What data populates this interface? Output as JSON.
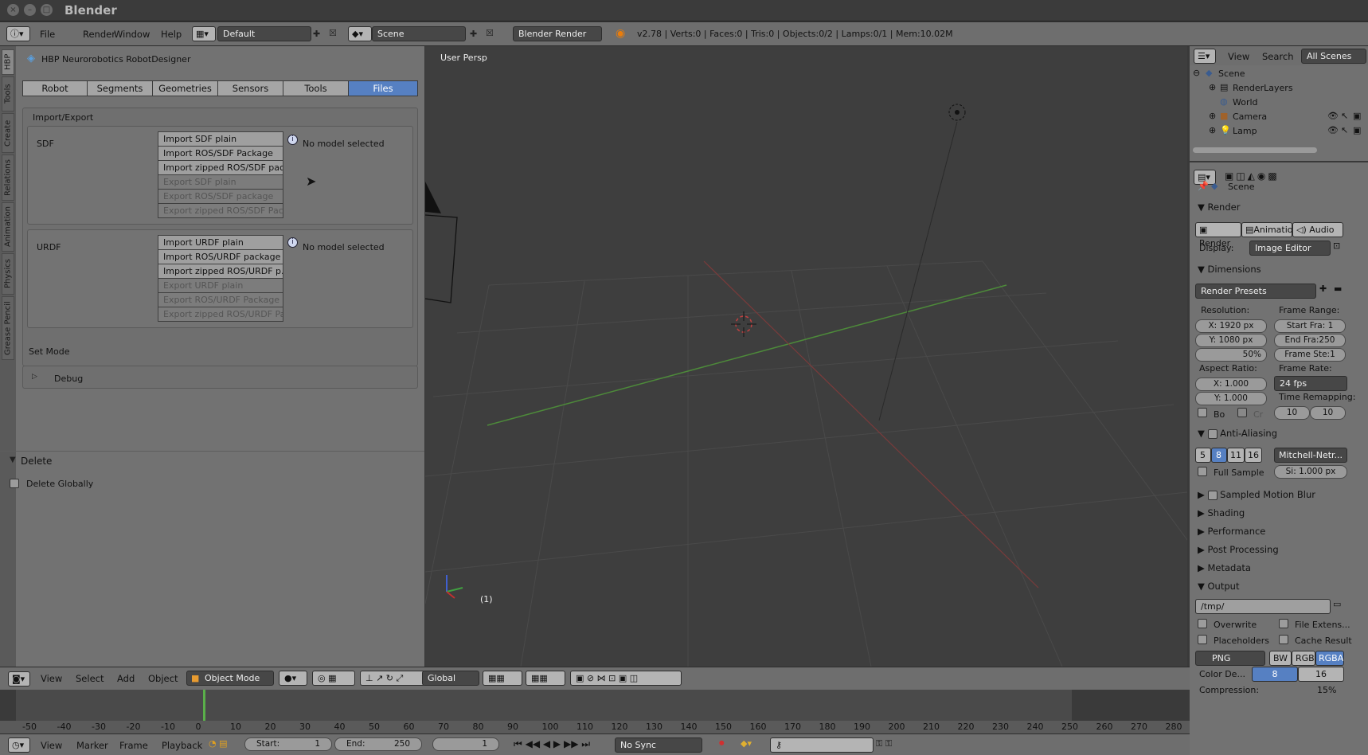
{
  "window": {
    "title": "Blender"
  },
  "info_header": {
    "menus": [
      "File",
      "Render",
      "Window",
      "Help"
    ],
    "layout": "Default",
    "scene": "Scene",
    "engine": "Blender Render",
    "stats": "v2.78 | Verts:0 | Faces:0 | Tris:0 | Objects:0/2 | Lamps:0/1 | Mem:10.02M"
  },
  "vertical_tabs": [
    "HBP",
    "Tools",
    "Create",
    "Relations",
    "Animation",
    "Physics",
    "Grease Pencil"
  ],
  "robot_designer": {
    "title": "HBP Neurorobotics RobotDesigner",
    "tabs": [
      "Robot",
      "Segments",
      "Geometries",
      "Sensors",
      "Tools",
      "Files"
    ],
    "active_tab": "Files",
    "section_label": "Import/Export",
    "sdf": {
      "label": "SDF",
      "buttons": [
        "Import SDF plain",
        "Import ROS/SDF Package",
        "Import zipped ROS/SDF pac...",
        "Export SDF plain",
        "Export ROS/SDF package",
        "Export zipped ROS/SDF Pac..."
      ],
      "status": "No model selected"
    },
    "urdf": {
      "label": "URDF",
      "buttons": [
        "Import URDF plain",
        "Import ROS/URDF package",
        "Import zipped ROS/URDF p...",
        "Export URDF plain",
        "Export ROS/URDF Package",
        "Export zipped ROS/URDF Pa..."
      ],
      "status": "No model selected"
    },
    "set_mode": "Set Mode",
    "debug": "Debug"
  },
  "delete_panel": {
    "title": "Delete",
    "option": "Delete Globally"
  },
  "viewport": {
    "label": "User Persp",
    "frame": "(1)"
  },
  "viewport_header": {
    "menus": [
      "View",
      "Select",
      "Add",
      "Object"
    ],
    "mode": "Object Mode",
    "orientation": "Global"
  },
  "timeline": {
    "ticks": [
      "-50",
      "-40",
      "-30",
      "-20",
      "-10",
      "0",
      "10",
      "20",
      "30",
      "40",
      "50",
      "60",
      "70",
      "80",
      "90",
      "100",
      "110",
      "120",
      "130",
      "140",
      "150",
      "160",
      "170",
      "180",
      "190",
      "200",
      "210",
      "220",
      "230",
      "240",
      "250",
      "260",
      "270",
      "280"
    ],
    "menus": [
      "View",
      "Marker",
      "Frame",
      "Playback"
    ],
    "start": "Start:",
    "start_val": "1",
    "end": "End:",
    "end_val": "250",
    "current": "1",
    "sync": "No Sync"
  },
  "outliner": {
    "menus": [
      "View",
      "Search",
      "All Scenes"
    ],
    "items": [
      "Scene",
      "RenderLayers",
      "World",
      "Camera",
      "Lamp"
    ]
  },
  "properties": {
    "context": "Scene",
    "render": {
      "title": "Render",
      "buttons": [
        "Render",
        "Animatio",
        "Audio"
      ],
      "display_label": "Display:",
      "display_value": "Image Editor"
    },
    "dimensions": {
      "title": "Dimensions",
      "presets": "Render Presets",
      "resolution_label": "Resolution:",
      "res_x": "X:  1920 px",
      "res_y": "Y:  1080 px",
      "res_pct": "50%",
      "frame_range_label": "Frame Range:",
      "start": "Start Fra:  1",
      "end": "End Fra:250",
      "step": "Frame Ste:1",
      "aspect_label": "Aspect Ratio:",
      "asp_x": "X:    1.000",
      "asp_y": "Y:    1.000",
      "frame_rate_label": "Frame Rate:",
      "fps": "24 fps",
      "remap_label": "Time Remapping:",
      "remap_old": "10",
      "remap_new": "10",
      "bo": "Bo",
      "cr": "Cr"
    },
    "aa": {
      "title": "Anti-Aliasing",
      "samples": [
        "5",
        "8",
        "11",
        "16"
      ],
      "filter": "Mitchell-Netr...",
      "full_sample": "Full Sample",
      "size": "Si: 1.000 px"
    },
    "collapsed": [
      "Sampled Motion Blur",
      "Shading",
      "Performance",
      "Post Processing",
      "Metadata"
    ],
    "output": {
      "title": "Output",
      "path": "/tmp/",
      "overwrite": "Overwrite",
      "file_ext": "File Extens...",
      "placeholders": "Placeholders",
      "cache": "Cache Result",
      "format": "PNG",
      "color_modes": [
        "BW",
        "RGB",
        "RGBA"
      ],
      "color_depth_label": "Color De...",
      "depths": [
        "8",
        "16"
      ],
      "compression": "Compression:",
      "compression_val": "15%"
    }
  }
}
